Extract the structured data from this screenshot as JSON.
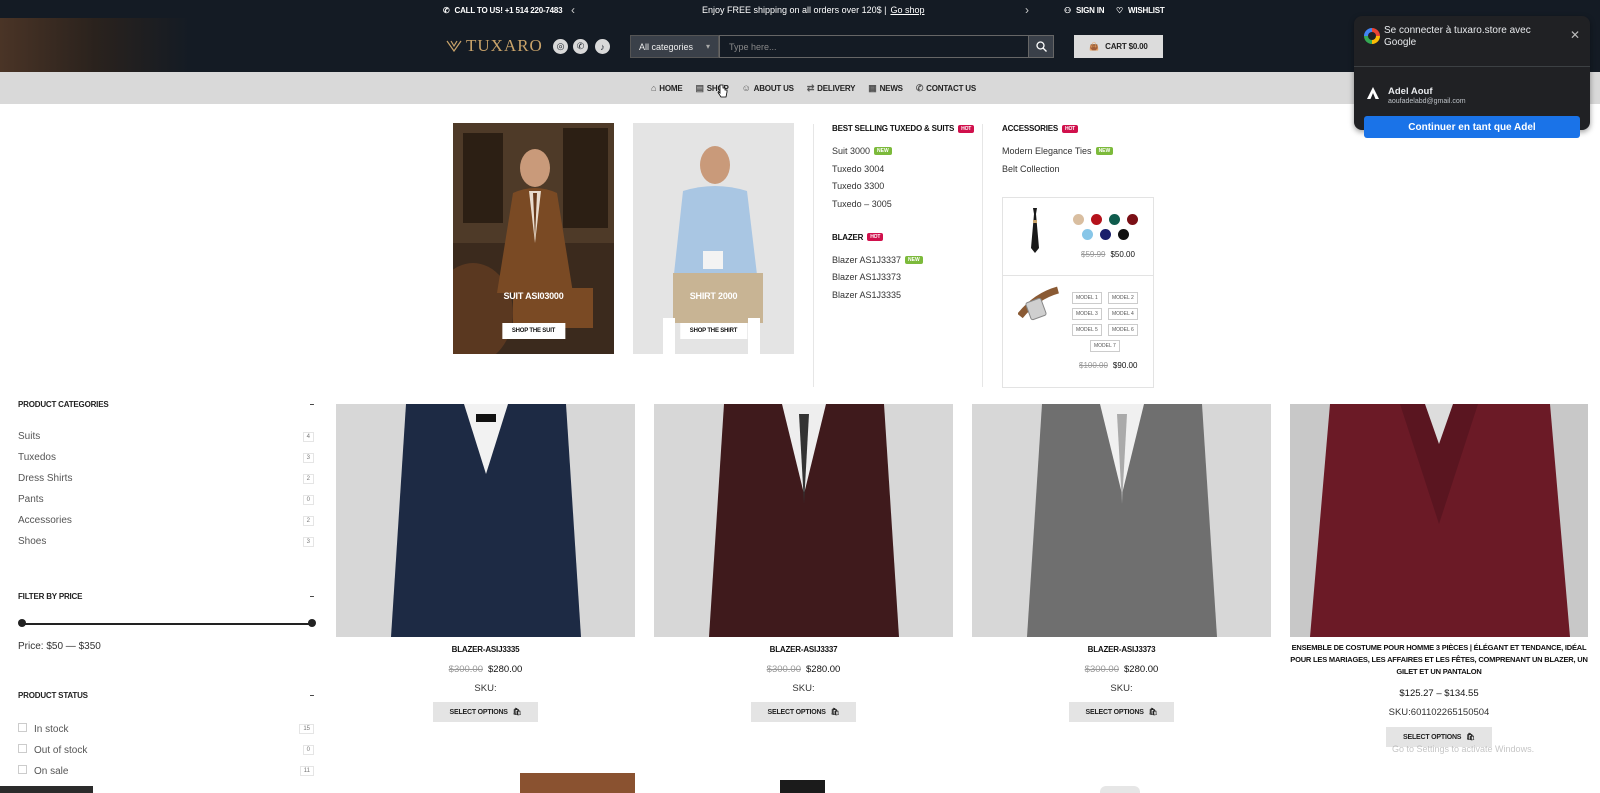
{
  "topbar": {
    "call_label": "CALL TO US! +1 514 220-7483",
    "promo_text": "Enjoy FREE shipping on all orders over 120$ |",
    "promo_link": "Go shop",
    "signin_label": "SIGN IN",
    "wishlist_label": "WISHLIST"
  },
  "header": {
    "logo_text": "TUXARO",
    "category_select": "All categories",
    "search_placeholder": "Type here...",
    "cart_label": "CART $0.00"
  },
  "nav": {
    "items": [
      {
        "label": "HOME",
        "icon": "home-icon"
      },
      {
        "label": "SHOP",
        "icon": "shop-icon"
      },
      {
        "label": "ABOUT US",
        "icon": "smile-icon"
      },
      {
        "label": "DELIVERY",
        "icon": "delivery-icon"
      },
      {
        "label": "NEWS",
        "icon": "news-icon"
      },
      {
        "label": "CONTACT US",
        "icon": "phone-icon"
      }
    ]
  },
  "mega_menu": {
    "card1": {
      "caption": "SUIT ASI03000",
      "button": "SHOP THE SUIT"
    },
    "card2": {
      "caption": "SHIRT 2000",
      "button": "SHOP THE SHIRT"
    },
    "col1": {
      "title": "BEST SELLING TUXEDO & SUITS",
      "title_badge": "HOT",
      "links": [
        {
          "label": "Suit 3000",
          "badge": "NEW"
        },
        {
          "label": "Tuxedo 3004",
          "badge": ""
        },
        {
          "label": "Tuxedo 3300",
          "badge": ""
        },
        {
          "label": "Tuxedo – 3005",
          "badge": ""
        }
      ],
      "title2": "BLAZER",
      "title2_badge": "HOT",
      "links2": [
        {
          "label": "Blazer AS1J3337",
          "badge": "NEW"
        },
        {
          "label": "Blazer AS1J3373",
          "badge": ""
        },
        {
          "label": "Blazer AS1J3335",
          "badge": ""
        }
      ]
    },
    "col2": {
      "title": "ACCESSORIES",
      "title_badge": "HOT",
      "links": [
        {
          "label": "Modern Elegance Ties",
          "badge": "NEW"
        },
        {
          "label": "Belt Collection",
          "badge": ""
        }
      ]
    },
    "tie_product": {
      "swatches": [
        "#d9bea0",
        "#b5121b",
        "#0f5c4d",
        "#7a0f15",
        "#87c6e8",
        "#1a1f6b",
        "#111111"
      ],
      "old_price": "$59.99",
      "price": "$50.00"
    },
    "belt_product": {
      "models": [
        "MODEL 1",
        "MODEL 2",
        "MODEL 3",
        "MODEL 4",
        "MODEL 5",
        "MODEL 6",
        "MODEL 7"
      ],
      "old_price": "$100.00",
      "price": "$90.00"
    }
  },
  "sidebar": {
    "categories_title": "PRODUCT CATEGORIES",
    "categories": [
      {
        "label": "Suits",
        "count": "4"
      },
      {
        "label": "Tuxedos",
        "count": "3"
      },
      {
        "label": "Dress Shirts",
        "count": "2"
      },
      {
        "label": "Pants",
        "count": "0"
      },
      {
        "label": "Accessories",
        "count": "2"
      },
      {
        "label": "Shoes",
        "count": "3"
      }
    ],
    "price_title": "FILTER BY PRICE",
    "price_text": "Price: $50 — $350",
    "status_title": "PRODUCT STATUS",
    "status": [
      {
        "label": "In stock",
        "count": "15"
      },
      {
        "label": "Out of stock",
        "count": "0"
      },
      {
        "label": "On sale",
        "count": "11"
      }
    ],
    "collapse_symbol": "–"
  },
  "products": [
    {
      "name": "BLAZER-ASIJ3335",
      "old_price": "$300.00",
      "price": "$280.00",
      "sku": "SKU:",
      "button": "SELECT OPTIONS",
      "color": "#1d2a44"
    },
    {
      "name": "BLAZER-ASIJ3337",
      "old_price": "$300.00",
      "price": "$280.00",
      "sku": "SKU:",
      "button": "SELECT OPTIONS",
      "color": "#3f1a1c"
    },
    {
      "name": "BLAZER-ASIJ3373",
      "old_price": "$300.00",
      "price": "$280.00",
      "sku": "SKU:",
      "button": "SELECT OPTIONS",
      "color": "#6f6f6f"
    },
    {
      "name": "ENSEMBLE DE COSTUME POUR HOMME 3 PIÈCES | ÉLÉGANT ET TENDANCE, IDÉAL POUR LES MARIAGES, LES AFFAIRES ET LES FÊTES, COMPRENANT UN BLAZER, UN GILET ET UN PANTALON",
      "old_price": "",
      "price": "$125.27 – $134.55",
      "sku": "SKU:601102265150504",
      "button": "SELECT OPTIONS",
      "color": "#6b1a26"
    }
  ],
  "google_popup": {
    "title": "Se connecter à tuxaro.store avec Google",
    "name": "Adel Aouf",
    "email": "aoufadelabd@gmail.com",
    "button": "Continuer en tant que Adel"
  },
  "watermark": "Go to Settings to activate Windows."
}
